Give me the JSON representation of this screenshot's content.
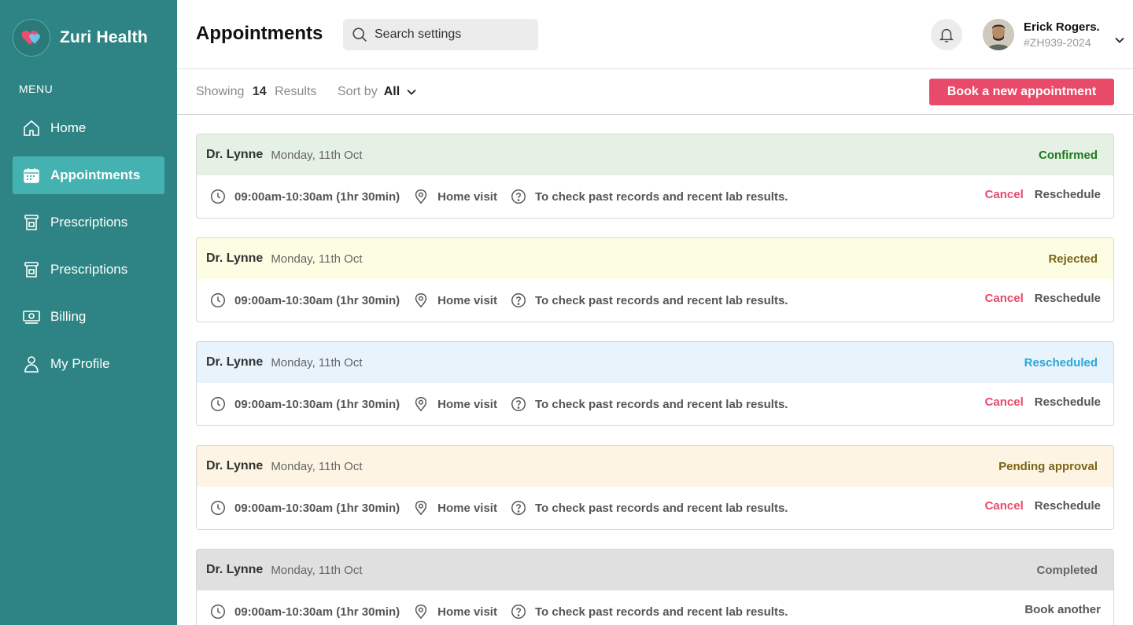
{
  "brand": {
    "name": "Zuri Health",
    "menu_label": "MENU"
  },
  "sidebar": {
    "items": [
      {
        "label": "Home",
        "icon": "home-icon",
        "active": false
      },
      {
        "label": "Appointments",
        "icon": "calendar-icon",
        "active": true
      },
      {
        "label": "Prescriptions",
        "icon": "pill-bottle-icon",
        "active": false
      },
      {
        "label": "Prescriptions",
        "icon": "pill-bottle-icon",
        "active": false
      },
      {
        "label": "Billing",
        "icon": "billing-icon",
        "active": false
      },
      {
        "label": "My Profile",
        "icon": "user-icon",
        "active": false
      }
    ]
  },
  "header": {
    "title": "Appointments",
    "search_placeholder": "Search settings",
    "user": {
      "name": "Erick Rogers.",
      "id": "#ZH939-2024"
    }
  },
  "filters": {
    "showing_label": "Showing",
    "count": "14",
    "results_label": "Results",
    "sort_label": "Sort by",
    "sort_value": "All",
    "book_button": "Book a new appointment"
  },
  "colors": {
    "sidebar": "#2e8484",
    "active_nav": "#45b2b2",
    "accent": "#e84a6a"
  },
  "appointments": [
    {
      "doctor": "Dr. Lynne",
      "date": "Monday, 11th Oct",
      "status": "Confirmed",
      "status_color": "#1d7a1d",
      "head_bg": "#e6f1e6",
      "time": "09:00am-10:30am (1hr 30min)",
      "location": "Home visit",
      "reason": "To check past records and recent lab results.",
      "actions": [
        "Cancel",
        "Reschedule"
      ]
    },
    {
      "doctor": "Dr. Lynne",
      "date": "Monday, 11th Oct",
      "status": "Rejected",
      "status_color": "#7a6518",
      "head_bg": "#fdfde3",
      "time": "09:00am-10:30am (1hr 30min)",
      "location": "Home visit",
      "reason": "To check past records and recent lab results.",
      "actions": [
        "Cancel",
        "Reschedule"
      ]
    },
    {
      "doctor": "Dr. Lynne",
      "date": "Monday, 11th Oct",
      "status": "Rescheduled",
      "status_color": "#2aa6d8",
      "head_bg": "#e8f3fc",
      "time": "09:00am-10:30am (1hr 30min)",
      "location": "Home visit",
      "reason": "To check past records and recent lab results.",
      "actions": [
        "Cancel",
        "Reschedule"
      ]
    },
    {
      "doctor": "Dr. Lynne",
      "date": "Monday, 11th Oct",
      "status": "Pending approval",
      "status_color": "#7a6518",
      "head_bg": "#fdf4e3",
      "time": "09:00am-10:30am (1hr 30min)",
      "location": "Home visit",
      "reason": "To check past records and recent lab results.",
      "actions": [
        "Cancel",
        "Reschedule"
      ]
    },
    {
      "doctor": "Dr. Lynne",
      "date": "Monday, 11th Oct",
      "status": "Completed",
      "status_color": "#666666",
      "head_bg": "#e0e0e0",
      "time": "09:00am-10:30am (1hr 30min)",
      "location": "Home visit",
      "reason": "To check past records and recent lab results.",
      "actions": [
        "Book another"
      ]
    }
  ]
}
